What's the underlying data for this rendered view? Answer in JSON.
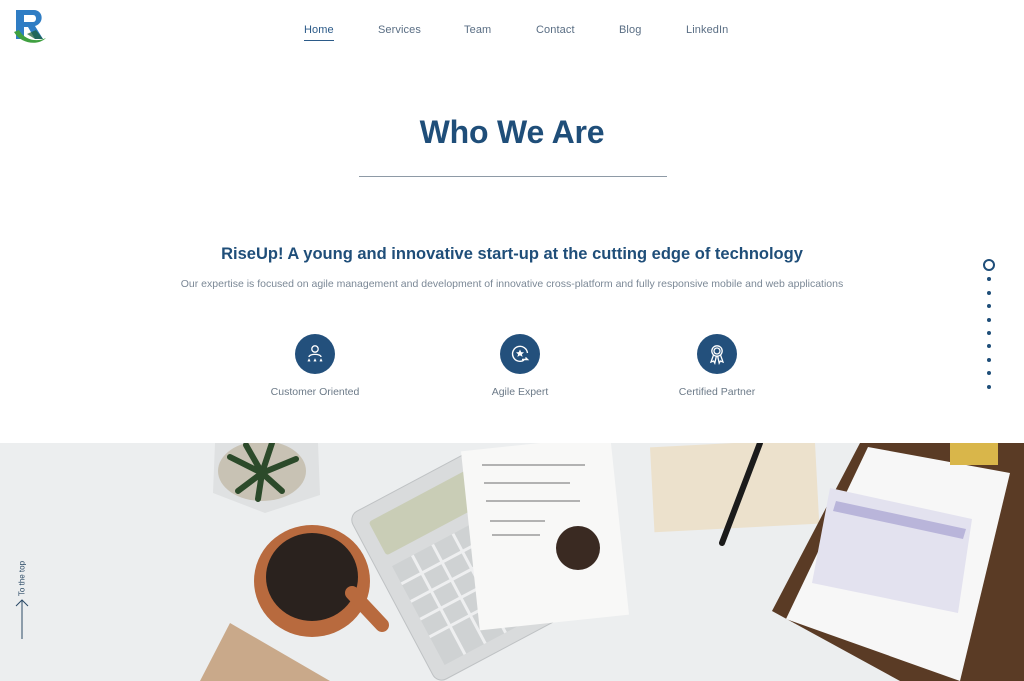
{
  "brand": {
    "logo_icon": "riseup-r-logo-icon",
    "colors": {
      "primary": "#1f4e79",
      "accent_blue": "#2f7dc4",
      "accent_green": "#3fa040"
    }
  },
  "nav": {
    "items": [
      {
        "label": "Home",
        "active": true
      },
      {
        "label": "Services",
        "active": false
      },
      {
        "label": "Team",
        "active": false
      },
      {
        "label": "Contact",
        "active": false
      },
      {
        "label": "Blog",
        "active": false
      },
      {
        "label": "LinkedIn",
        "active": false
      }
    ]
  },
  "main": {
    "title": "Who We Are",
    "subtitle": "RiseUp! A young and innovative start-up at the cutting edge of technology",
    "description": "Our expertise is focused on agile management and development of innovative cross-platform and fully responsive mobile and web applications",
    "features": [
      {
        "label": "Customer Oriented",
        "icon": "customer-rating-icon"
      },
      {
        "label": "Agile Expert",
        "icon": "agile-star-cycle-icon"
      },
      {
        "label": "Certified Partner",
        "icon": "award-ribbon-icon"
      }
    ]
  },
  "section_nav": {
    "count": 9,
    "active_index": 0
  },
  "scroll_to_top": {
    "label": "To the top",
    "icon": "arrow-up-icon"
  }
}
